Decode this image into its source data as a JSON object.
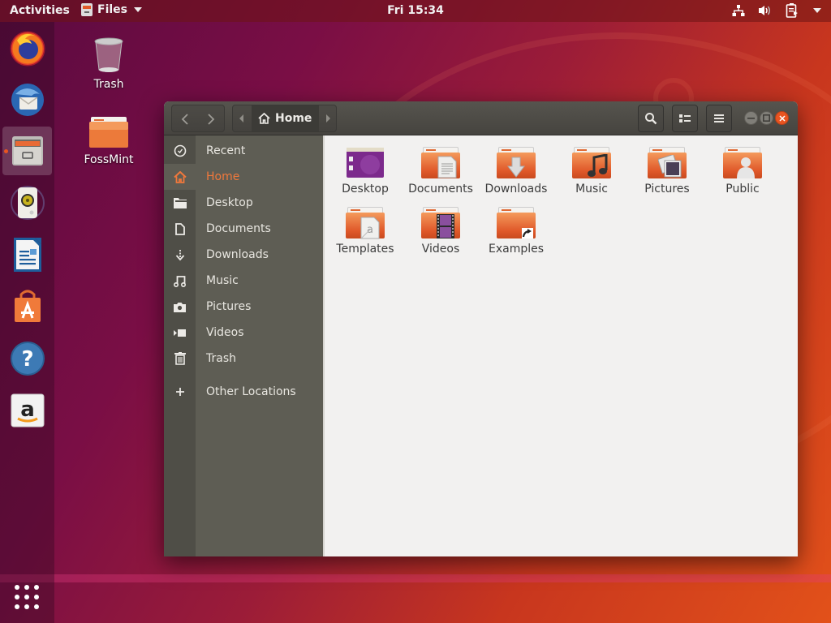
{
  "topbar": {
    "activities_label": "Activities",
    "app_menu_label": "Files",
    "clock": "Fri 15:34",
    "tray_icons": [
      "network-icon",
      "volume-icon",
      "battery-icon",
      "system-menu-caret"
    ]
  },
  "dock": {
    "items": [
      {
        "name": "firefox",
        "icon": "firefox-icon"
      },
      {
        "name": "thunderbird",
        "icon": "thunderbird-icon"
      },
      {
        "name": "files",
        "icon": "files-icon",
        "active": true,
        "running": true
      },
      {
        "name": "rhythmbox",
        "icon": "rhythmbox-icon"
      },
      {
        "name": "libreoffice-writer",
        "icon": "writer-icon"
      },
      {
        "name": "ubuntu-software",
        "icon": "software-icon"
      },
      {
        "name": "help",
        "icon": "help-icon"
      },
      {
        "name": "amazon",
        "icon": "amazon-icon"
      }
    ],
    "show_apps_icon": "app-grid-icon"
  },
  "desktop": {
    "icons": [
      {
        "label": "Trash",
        "icon": "trash-icon"
      },
      {
        "label": "FossMint",
        "icon": "folder-icon"
      }
    ]
  },
  "window": {
    "path": {
      "current": "Home"
    },
    "sidebar": {
      "items": [
        {
          "label": "Recent",
          "icon": "clock-icon"
        },
        {
          "label": "Home",
          "icon": "home-icon",
          "selected": true
        },
        {
          "label": "Desktop",
          "icon": "folder-icon"
        },
        {
          "label": "Documents",
          "icon": "document-icon"
        },
        {
          "label": "Downloads",
          "icon": "download-icon"
        },
        {
          "label": "Music",
          "icon": "music-icon"
        },
        {
          "label": "Pictures",
          "icon": "camera-icon"
        },
        {
          "label": "Videos",
          "icon": "video-icon"
        },
        {
          "label": "Trash",
          "icon": "trash-icon"
        },
        {
          "label": "Other Locations",
          "icon": "plus-icon"
        }
      ]
    },
    "files": [
      {
        "label": "Desktop",
        "type": "desktop"
      },
      {
        "label": "Documents",
        "type": "documents"
      },
      {
        "label": "Downloads",
        "type": "downloads"
      },
      {
        "label": "Music",
        "type": "music"
      },
      {
        "label": "Pictures",
        "type": "pictures"
      },
      {
        "label": "Public",
        "type": "public"
      },
      {
        "label": "Templates",
        "type": "templates"
      },
      {
        "label": "Videos",
        "type": "videos"
      },
      {
        "label": "Examples",
        "type": "examples"
      }
    ]
  },
  "colors": {
    "accent": "#e95420",
    "sidebar_bg": "#5e5d54",
    "headerbar_bg": "#4b4a45",
    "content_bg": "#f2f1f0"
  }
}
